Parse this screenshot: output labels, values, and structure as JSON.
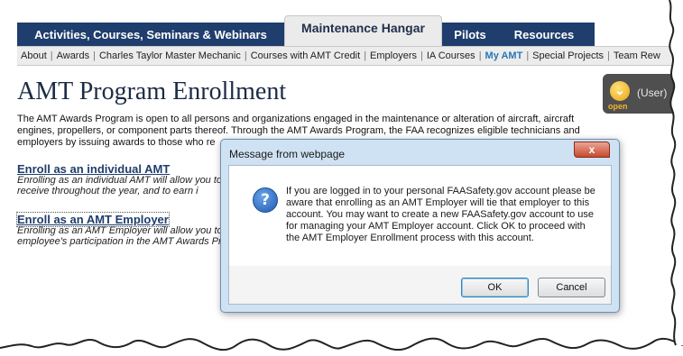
{
  "nav": {
    "tabs": [
      "Activities, Courses, Seminars & Webinars",
      "Maintenance Hangar",
      "Pilots",
      "Resources"
    ],
    "subnav": [
      "About",
      "Awards",
      "Charles Taylor Master Mechanic",
      "Courses with AMT Credit",
      "Employers",
      "IA Courses",
      "My AMT",
      "Special Projects",
      "Team Rew"
    ],
    "separator": "|"
  },
  "badge": {
    "status": "open",
    "user": "(User)",
    "icon": "chevron-down-icon"
  },
  "page": {
    "title": "AMT Program Enrollment",
    "intro": "The AMT Awards Program is open to all persons and organizations engaged in the maintenance or alteration of aircraft, aircraft engines, propellers, or component parts thereof. Through the AMT Awards Program, the FAA recognizes eligible technicians and employers by issuing awards to those who re",
    "sections": [
      {
        "link": "Enroll as an individual AMT",
        "desc": "Enrolling as an individual AMT will allow you to you receive throughout the year, and to earn i"
      },
      {
        "link": "Enroll as an AMT Employer",
        "desc": "Enrolling as an AMT Employer will allow you to employee's participation in the AMT Awards Pr"
      }
    ]
  },
  "dialog": {
    "title": "Message from webpage",
    "close_label": "x",
    "icon": "question-icon",
    "icon_glyph": "?",
    "message": "If you are logged in to your personal FAASafety.gov account please be aware that enrolling as an AMT Employer will tie that employer to this account. You may want to create a new FAASafety.gov account to use for managing your AMT Employer account. Click OK to proceed with the AMT Employer Enrollment process with this account.",
    "ok": "OK",
    "cancel": "Cancel"
  },
  "colors": {
    "tabbar": "#1f3d6d",
    "active_subnav": "#2b76b8",
    "dialog_frame": "#cfe2f3",
    "close_button": "#c84a30"
  }
}
